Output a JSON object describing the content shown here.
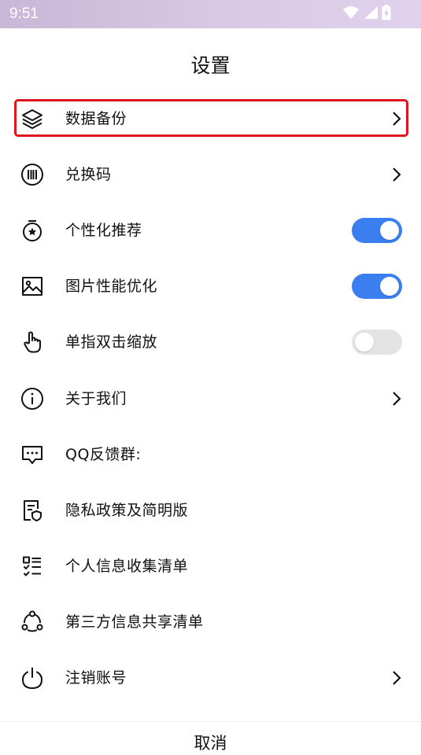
{
  "status_bar": {
    "time": "9:51",
    "icons": [
      "wifi-icon",
      "signal-icon",
      "battery-charging-icon"
    ]
  },
  "header": {
    "title": "设置"
  },
  "settings": {
    "items": [
      {
        "label": "数据备份",
        "icon": "layers-icon",
        "control": "chevron",
        "highlighted": true
      },
      {
        "label": "兑换码",
        "icon": "barcode-icon",
        "control": "chevron"
      },
      {
        "label": "个性化推荐",
        "icon": "badge-star-icon",
        "control": "toggle",
        "toggle_on": true
      },
      {
        "label": "图片性能优化",
        "icon": "image-icon",
        "control": "toggle",
        "toggle_on": true
      },
      {
        "label": "单指双击缩放",
        "icon": "hand-pointer-icon",
        "control": "toggle",
        "toggle_on": false
      },
      {
        "label": "关于我们",
        "icon": "info-icon",
        "control": "chevron"
      },
      {
        "label": "QQ反馈群:",
        "icon": "chat-bubble-icon",
        "control": "none"
      },
      {
        "label": "隐私政策及简明版",
        "icon": "document-shield-icon",
        "control": "none"
      },
      {
        "label": "个人信息收集清单",
        "icon": "checklist-icon",
        "control": "none"
      },
      {
        "label": "第三方信息共享清单",
        "icon": "share-nodes-icon",
        "control": "none"
      },
      {
        "label": "注销账号",
        "icon": "power-icon",
        "control": "chevron"
      }
    ]
  },
  "footer": {
    "cancel_label": "取消"
  },
  "colors": {
    "toggle_on": "#3a7ef0",
    "toggle_off": "#e4e4e4",
    "highlight_border": "#e0141e",
    "status_bar_gradient": [
      "#c8b7d6",
      "#e0d2ec"
    ]
  }
}
